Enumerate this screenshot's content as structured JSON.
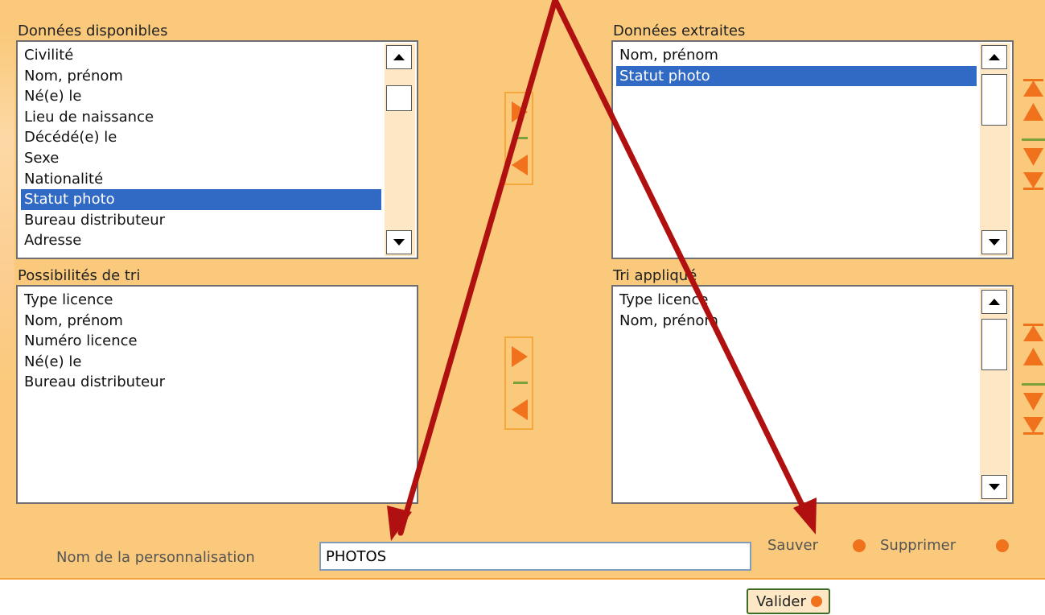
{
  "available": {
    "label": "Données disponibles",
    "items": [
      "Civilité",
      "Nom, prénom",
      "Né(e) le",
      "Lieu de naissance",
      "Décédé(e) le",
      "Sexe",
      "Nationalité",
      "Statut photo",
      "Bureau distributeur",
      "Adresse"
    ],
    "selected_index": 7
  },
  "extracted": {
    "label": "Données extraites",
    "items": [
      "Nom, prénom",
      "Statut photo"
    ],
    "selected_index": 1
  },
  "sort_options": {
    "label": "Possibilités de tri",
    "items": [
      "Type licence",
      "Nom, prénom",
      "Numéro licence",
      "Né(e) le",
      "Bureau distributeur"
    ]
  },
  "sort_applied": {
    "label": "Tri appliqué",
    "items": [
      "Type licence",
      "Nom, prénom"
    ]
  },
  "customization": {
    "label": "Nom de la personnalisation",
    "value": "PHOTOS"
  },
  "actions": {
    "save": "Sauver",
    "delete": "Supprimer",
    "validate": "Valider"
  },
  "colors": {
    "panel": "#fac97b",
    "accent": "#f0721d",
    "selection": "#316ac5",
    "annotation": "#b01010"
  }
}
